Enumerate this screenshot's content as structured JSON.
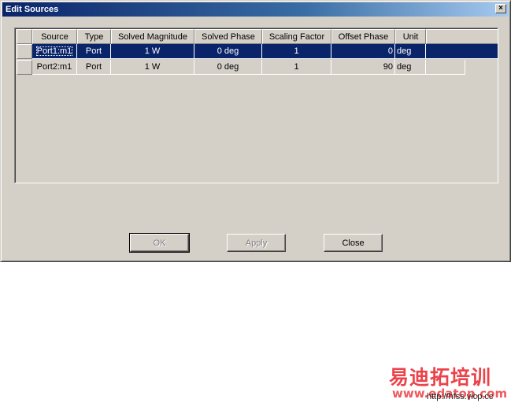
{
  "window": {
    "title": "Edit Sources",
    "close_glyph": "×"
  },
  "table": {
    "columns": [
      "Source",
      "Type",
      "Solved Magnitude",
      "Solved Phase",
      "Scaling Factor",
      "Offset Phase",
      "Unit"
    ],
    "rows": [
      {
        "source": "Port1:m1",
        "type": "Port",
        "solved_magnitude": "1 W",
        "solved_phase": "0 deg",
        "scaling_factor": "1",
        "offset_phase": "0",
        "unit": "deg",
        "selected": true
      },
      {
        "source": "Port2:m1",
        "type": "Port",
        "solved_magnitude": "1 W",
        "solved_phase": "0 deg",
        "scaling_factor": "1",
        "offset_phase": "90",
        "unit": "deg",
        "selected": false
      }
    ]
  },
  "buttons": {
    "ok": "OK",
    "apply": "Apply",
    "close": "Close"
  },
  "watermark": {
    "chinese": "易迪拓培训",
    "url": "www.edatop.com",
    "small_url": "http://hfss.vicp.cc"
  },
  "colors": {
    "selection": "#0a246a",
    "face": "#d4d0c8",
    "watermark": "#e8232a"
  }
}
